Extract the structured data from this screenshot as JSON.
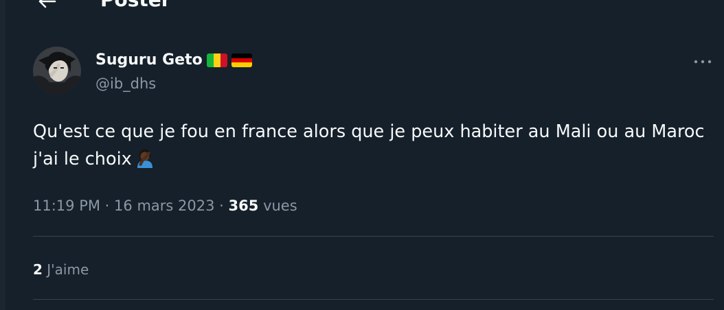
{
  "header": {
    "title": "Poster",
    "back_icon": "arrow-left-icon"
  },
  "tweet": {
    "author": {
      "name": "Suguru Geto",
      "handle": "@ib_dhs",
      "flags": [
        "mali-flag-icon",
        "germany-flag-icon"
      ]
    },
    "more_icon": "more-dots-icon",
    "text": "Qu'est ce que je fou en france alors que je peux habiter au Mali ou au Maroc j'ai le choix",
    "emoji": "facepalm-icon",
    "time": "11:19 PM",
    "date": "16 mars 2023",
    "separator": "·",
    "views_count": "365",
    "views_label": "vues",
    "likes_count": "2",
    "likes_label": "J'aime"
  },
  "colors": {
    "background": "#15202b",
    "text_primary": "#f7f9f9",
    "text_secondary": "#8b98a5",
    "divider": "#38444d"
  }
}
